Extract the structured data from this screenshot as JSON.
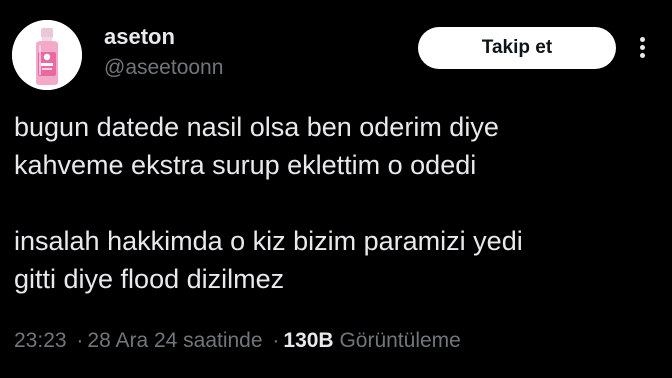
{
  "colors": {
    "background": "#000000",
    "primary_text": "#e7e9ea",
    "secondary_text": "#71767b",
    "button_bg": "#ffffff",
    "button_text": "#0f1419"
  },
  "author": {
    "display_name": "aseton",
    "handle": "@aseetoonn",
    "avatar_icon": "pink-acetone-bottle-icon"
  },
  "actions": {
    "follow_label": "Takip et",
    "more_icon": "more-dots-vertical-icon"
  },
  "tweet": {
    "paragraphs": [
      "bugun datede nasil olsa ben oderim diye\nkahveme ekstra surup eklettim o odedi",
      "insalah hakkimda o kiz bizim paramizi yedi\ngitti diye flood dizilmez"
    ]
  },
  "meta": {
    "time": "23:23",
    "separator": "·",
    "date": "28 Ara 24 saatinde",
    "views_count": "130B",
    "views_label": "Görüntüleme"
  }
}
